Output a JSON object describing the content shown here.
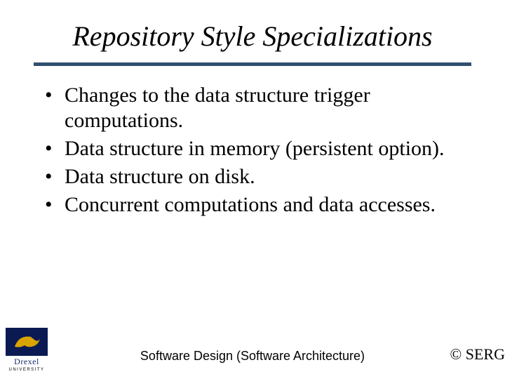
{
  "title": "Repository Style Specializations",
  "bullets": [
    "Changes to the data structure trigger computations.",
    "Data structure in memory (persistent option).",
    "Data structure on disk.",
    "Concurrent computations and data accesses."
  ],
  "footer": {
    "center": "Software Design (Software Architecture)",
    "right": "© SERG",
    "logo_name": "Drexel",
    "logo_sub": "UNIVERSITY"
  }
}
